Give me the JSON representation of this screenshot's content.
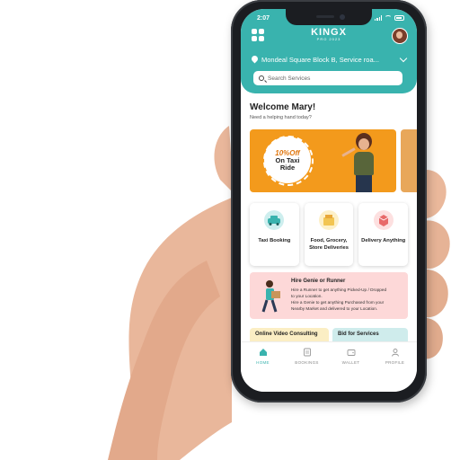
{
  "status": {
    "time": "2:07"
  },
  "brand": {
    "name": "KINGX",
    "subtitle": "PRO 2023"
  },
  "location": {
    "text": "Mondeal Square Block B, Service roa..."
  },
  "search": {
    "placeholder": "Search Services"
  },
  "welcome": {
    "title": "Welcome Mary!",
    "subtitle": "Need a helping hand today?"
  },
  "promo": {
    "offer": "10%Off",
    "line1": "On Taxi",
    "line2": "Ride"
  },
  "services": [
    {
      "label": "Taxi Booking",
      "icon": "taxi-icon"
    },
    {
      "label": "Food, Grocery, Store Deliveries",
      "icon": "grocery-icon"
    },
    {
      "label": "Delivery Anything",
      "icon": "delivery-box-icon"
    }
  ],
  "genie": {
    "title": "Hire Genie or Runner",
    "line1": "Hire a Runner to get anything Picked-Up / Dropped",
    "line2": "to your Location.",
    "line3": "Hire a Genie to get anything Purchased from your",
    "line4": "Nearby Market and delivered to your Location."
  },
  "bottom_cards": {
    "left": "Online Video Consulting",
    "right": "Bid for Services"
  },
  "nav": [
    {
      "label": "HOME",
      "icon": "home-icon",
      "active": true
    },
    {
      "label": "BOOKINGS",
      "icon": "bookings-icon",
      "active": false
    },
    {
      "label": "WALLET",
      "icon": "wallet-icon",
      "active": false
    },
    {
      "label": "PROFILE",
      "icon": "profile-icon",
      "active": false
    }
  ],
  "colors": {
    "accent": "#39b3ae",
    "promo": "#f39a1c",
    "genie_bg": "#fdd8d8"
  }
}
